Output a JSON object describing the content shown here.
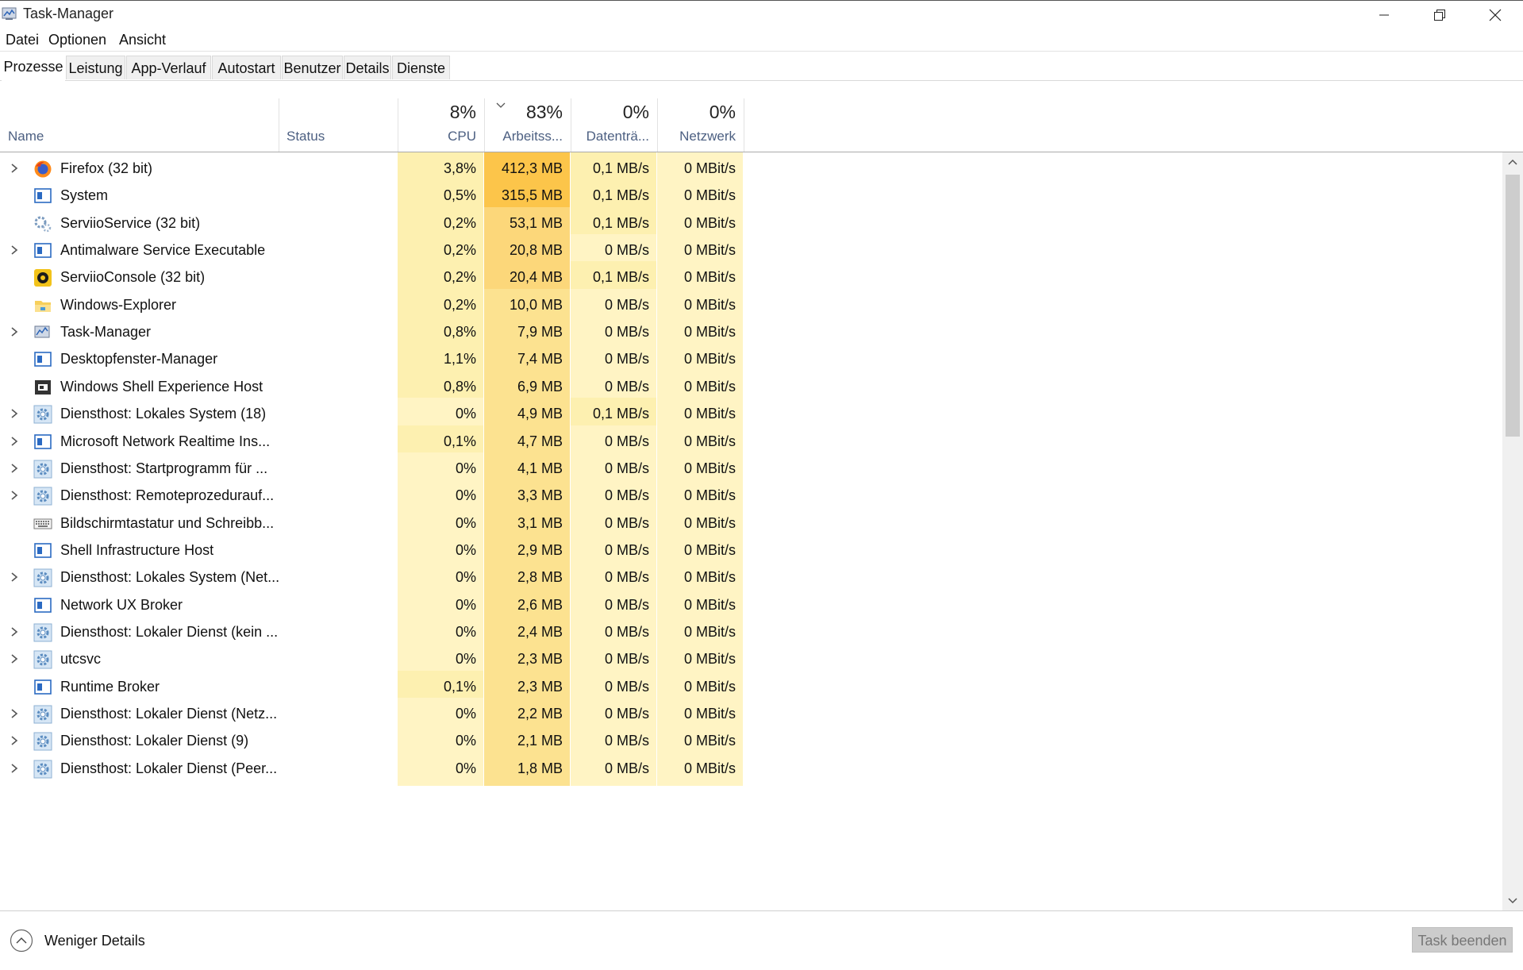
{
  "window": {
    "title": "Task-Manager"
  },
  "menu": [
    "Datei",
    "Optionen",
    "Ansicht"
  ],
  "tabs": [
    "Prozesse",
    "Leistung",
    "App-Verlauf",
    "Autostart",
    "Benutzer",
    "Details",
    "Dienste"
  ],
  "active_tab": "Prozesse",
  "header": {
    "name": "Name",
    "status": "Status",
    "cpu_pct": "8%",
    "cpu": "CPU",
    "mem_pct": "83%",
    "mem": "Arbeitss...",
    "disk_pct": "0%",
    "disk": "Datenträ...",
    "net_pct": "0%",
    "net": "Netzwerk"
  },
  "processes": [
    {
      "name": "Firefox (32 bit)",
      "icon": "firefox-icon",
      "expandable": true,
      "cpu": "3,8%",
      "mem": "412,3 MB",
      "disk": "0,1 MB/s",
      "net": "0 MBit/s"
    },
    {
      "name": "System",
      "icon": "window-icon",
      "expandable": false,
      "cpu": "0,5%",
      "mem": "315,5 MB",
      "disk": "0,1 MB/s",
      "net": "0 MBit/s"
    },
    {
      "name": "ServiioService (32 bit)",
      "icon": "service-gears-icon",
      "expandable": false,
      "cpu": "0,2%",
      "mem": "53,1 MB",
      "disk": "0,1 MB/s",
      "net": "0 MBit/s"
    },
    {
      "name": "Antimalware Service Executable",
      "icon": "window-icon",
      "expandable": true,
      "cpu": "0,2%",
      "mem": "20,8 MB",
      "disk": "0 MB/s",
      "net": "0 MBit/s"
    },
    {
      "name": "ServiioConsole (32 bit)",
      "icon": "serviio-icon",
      "expandable": false,
      "cpu": "0,2%",
      "mem": "20,4 MB",
      "disk": "0,1 MB/s",
      "net": "0 MBit/s"
    },
    {
      "name": "Windows-Explorer",
      "icon": "folder-icon",
      "expandable": false,
      "cpu": "0,2%",
      "mem": "10,0 MB",
      "disk": "0 MB/s",
      "net": "0 MBit/s"
    },
    {
      "name": "Task-Manager",
      "icon": "taskmanager-icon",
      "expandable": true,
      "cpu": "0,8%",
      "mem": "7,9 MB",
      "disk": "0 MB/s",
      "net": "0 MBit/s"
    },
    {
      "name": "Desktopfenster-Manager",
      "icon": "window-icon",
      "expandable": false,
      "cpu": "1,1%",
      "mem": "7,4 MB",
      "disk": "0 MB/s",
      "net": "0 MBit/s"
    },
    {
      "name": "Windows Shell Experience Host",
      "icon": "dark-window-icon",
      "expandable": false,
      "cpu": "0,8%",
      "mem": "6,9 MB",
      "disk": "0 MB/s",
      "net": "0 MBit/s"
    },
    {
      "name": "Diensthost: Lokales System (18)",
      "icon": "gear-icon",
      "expandable": true,
      "cpu": "0%",
      "mem": "4,9 MB",
      "disk": "0,1 MB/s",
      "net": "0 MBit/s"
    },
    {
      "name": "Microsoft Network Realtime Ins...",
      "icon": "window-icon",
      "expandable": true,
      "cpu": "0,1%",
      "mem": "4,7 MB",
      "disk": "0 MB/s",
      "net": "0 MBit/s"
    },
    {
      "name": "Diensthost: Startprogramm für ...",
      "icon": "gear-icon",
      "expandable": true,
      "cpu": "0%",
      "mem": "4,1 MB",
      "disk": "0 MB/s",
      "net": "0 MBit/s"
    },
    {
      "name": "Diensthost: Remoteprozedurauf...",
      "icon": "gear-icon",
      "expandable": true,
      "cpu": "0%",
      "mem": "3,3 MB",
      "disk": "0 MB/s",
      "net": "0 MBit/s"
    },
    {
      "name": "Bildschirmtastatur und Schreibb...",
      "icon": "keyboard-icon",
      "expandable": false,
      "cpu": "0%",
      "mem": "3,1 MB",
      "disk": "0 MB/s",
      "net": "0 MBit/s"
    },
    {
      "name": "Shell Infrastructure Host",
      "icon": "window-icon",
      "expandable": false,
      "cpu": "0%",
      "mem": "2,9 MB",
      "disk": "0 MB/s",
      "net": "0 MBit/s"
    },
    {
      "name": "Diensthost: Lokales System (Net...",
      "icon": "gear-icon",
      "expandable": true,
      "cpu": "0%",
      "mem": "2,8 MB",
      "disk": "0 MB/s",
      "net": "0 MBit/s"
    },
    {
      "name": "Network UX Broker",
      "icon": "window-icon",
      "expandable": false,
      "cpu": "0%",
      "mem": "2,6 MB",
      "disk": "0 MB/s",
      "net": "0 MBit/s"
    },
    {
      "name": "Diensthost: Lokaler Dienst (kein ...",
      "icon": "gear-icon",
      "expandable": true,
      "cpu": "0%",
      "mem": "2,4 MB",
      "disk": "0 MB/s",
      "net": "0 MBit/s"
    },
    {
      "name": "utcsvc",
      "icon": "gear-icon",
      "expandable": true,
      "cpu": "0%",
      "mem": "2,3 MB",
      "disk": "0 MB/s",
      "net": "0 MBit/s"
    },
    {
      "name": "Runtime Broker",
      "icon": "window-icon",
      "expandable": false,
      "cpu": "0,1%",
      "mem": "2,3 MB",
      "disk": "0 MB/s",
      "net": "0 MBit/s"
    },
    {
      "name": "Diensthost: Lokaler Dienst (Netz...",
      "icon": "gear-icon",
      "expandable": true,
      "cpu": "0%",
      "mem": "2,2 MB",
      "disk": "0 MB/s",
      "net": "0 MBit/s"
    },
    {
      "name": "Diensthost: Lokaler Dienst (9)",
      "icon": "gear-icon",
      "expandable": true,
      "cpu": "0%",
      "mem": "2,1 MB",
      "disk": "0 MB/s",
      "net": "0 MBit/s"
    },
    {
      "name": "Diensthost: Lokaler Dienst (Peer...",
      "icon": "gear-icon",
      "expandable": true,
      "cpu": "0%",
      "mem": "1,8 MB",
      "disk": "0 MB/s",
      "net": "0 MBit/s"
    }
  ],
  "footer": {
    "less_details": "Weniger Details",
    "end_task": "Task beenden"
  },
  "colors": {
    "heat_0": "#fff4c4",
    "heat_1": "#fdf0b0",
    "heat_2": "#fce290",
    "heat_3": "#fcd77a",
    "heat_4": "#fcc54a",
    "accent_text": "#4d6082"
  }
}
